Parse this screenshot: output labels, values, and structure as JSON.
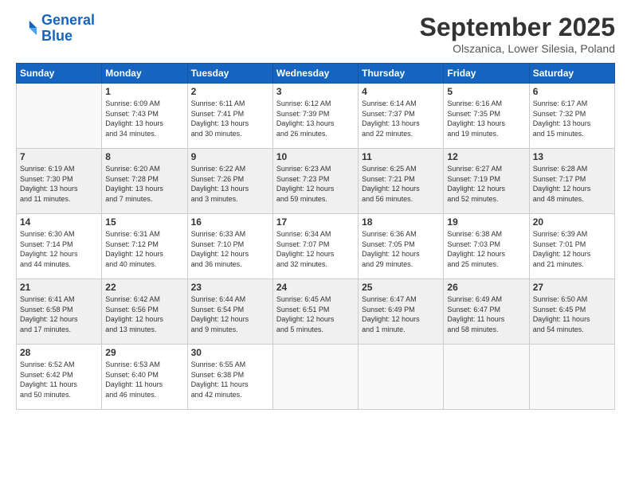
{
  "logo": {
    "line1": "General",
    "line2": "Blue"
  },
  "title": "September 2025",
  "location": "Olszanica, Lower Silesia, Poland",
  "weekdays": [
    "Sunday",
    "Monday",
    "Tuesday",
    "Wednesday",
    "Thursday",
    "Friday",
    "Saturday"
  ],
  "weeks": [
    [
      {
        "day": "",
        "info": ""
      },
      {
        "day": "1",
        "info": "Sunrise: 6:09 AM\nSunset: 7:43 PM\nDaylight: 13 hours\nand 34 minutes."
      },
      {
        "day": "2",
        "info": "Sunrise: 6:11 AM\nSunset: 7:41 PM\nDaylight: 13 hours\nand 30 minutes."
      },
      {
        "day": "3",
        "info": "Sunrise: 6:12 AM\nSunset: 7:39 PM\nDaylight: 13 hours\nand 26 minutes."
      },
      {
        "day": "4",
        "info": "Sunrise: 6:14 AM\nSunset: 7:37 PM\nDaylight: 13 hours\nand 22 minutes."
      },
      {
        "day": "5",
        "info": "Sunrise: 6:16 AM\nSunset: 7:35 PM\nDaylight: 13 hours\nand 19 minutes."
      },
      {
        "day": "6",
        "info": "Sunrise: 6:17 AM\nSunset: 7:32 PM\nDaylight: 13 hours\nand 15 minutes."
      }
    ],
    [
      {
        "day": "7",
        "info": "Sunrise: 6:19 AM\nSunset: 7:30 PM\nDaylight: 13 hours\nand 11 minutes."
      },
      {
        "day": "8",
        "info": "Sunrise: 6:20 AM\nSunset: 7:28 PM\nDaylight: 13 hours\nand 7 minutes."
      },
      {
        "day": "9",
        "info": "Sunrise: 6:22 AM\nSunset: 7:26 PM\nDaylight: 13 hours\nand 3 minutes."
      },
      {
        "day": "10",
        "info": "Sunrise: 6:23 AM\nSunset: 7:23 PM\nDaylight: 12 hours\nand 59 minutes."
      },
      {
        "day": "11",
        "info": "Sunrise: 6:25 AM\nSunset: 7:21 PM\nDaylight: 12 hours\nand 56 minutes."
      },
      {
        "day": "12",
        "info": "Sunrise: 6:27 AM\nSunset: 7:19 PM\nDaylight: 12 hours\nand 52 minutes."
      },
      {
        "day": "13",
        "info": "Sunrise: 6:28 AM\nSunset: 7:17 PM\nDaylight: 12 hours\nand 48 minutes."
      }
    ],
    [
      {
        "day": "14",
        "info": "Sunrise: 6:30 AM\nSunset: 7:14 PM\nDaylight: 12 hours\nand 44 minutes."
      },
      {
        "day": "15",
        "info": "Sunrise: 6:31 AM\nSunset: 7:12 PM\nDaylight: 12 hours\nand 40 minutes."
      },
      {
        "day": "16",
        "info": "Sunrise: 6:33 AM\nSunset: 7:10 PM\nDaylight: 12 hours\nand 36 minutes."
      },
      {
        "day": "17",
        "info": "Sunrise: 6:34 AM\nSunset: 7:07 PM\nDaylight: 12 hours\nand 32 minutes."
      },
      {
        "day": "18",
        "info": "Sunrise: 6:36 AM\nSunset: 7:05 PM\nDaylight: 12 hours\nand 29 minutes."
      },
      {
        "day": "19",
        "info": "Sunrise: 6:38 AM\nSunset: 7:03 PM\nDaylight: 12 hours\nand 25 minutes."
      },
      {
        "day": "20",
        "info": "Sunrise: 6:39 AM\nSunset: 7:01 PM\nDaylight: 12 hours\nand 21 minutes."
      }
    ],
    [
      {
        "day": "21",
        "info": "Sunrise: 6:41 AM\nSunset: 6:58 PM\nDaylight: 12 hours\nand 17 minutes."
      },
      {
        "day": "22",
        "info": "Sunrise: 6:42 AM\nSunset: 6:56 PM\nDaylight: 12 hours\nand 13 minutes."
      },
      {
        "day": "23",
        "info": "Sunrise: 6:44 AM\nSunset: 6:54 PM\nDaylight: 12 hours\nand 9 minutes."
      },
      {
        "day": "24",
        "info": "Sunrise: 6:45 AM\nSunset: 6:51 PM\nDaylight: 12 hours\nand 5 minutes."
      },
      {
        "day": "25",
        "info": "Sunrise: 6:47 AM\nSunset: 6:49 PM\nDaylight: 12 hours\nand 1 minute."
      },
      {
        "day": "26",
        "info": "Sunrise: 6:49 AM\nSunset: 6:47 PM\nDaylight: 11 hours\nand 58 minutes."
      },
      {
        "day": "27",
        "info": "Sunrise: 6:50 AM\nSunset: 6:45 PM\nDaylight: 11 hours\nand 54 minutes."
      }
    ],
    [
      {
        "day": "28",
        "info": "Sunrise: 6:52 AM\nSunset: 6:42 PM\nDaylight: 11 hours\nand 50 minutes."
      },
      {
        "day": "29",
        "info": "Sunrise: 6:53 AM\nSunset: 6:40 PM\nDaylight: 11 hours\nand 46 minutes."
      },
      {
        "day": "30",
        "info": "Sunrise: 6:55 AM\nSunset: 6:38 PM\nDaylight: 11 hours\nand 42 minutes."
      },
      {
        "day": "",
        "info": ""
      },
      {
        "day": "",
        "info": ""
      },
      {
        "day": "",
        "info": ""
      },
      {
        "day": "",
        "info": ""
      }
    ]
  ]
}
